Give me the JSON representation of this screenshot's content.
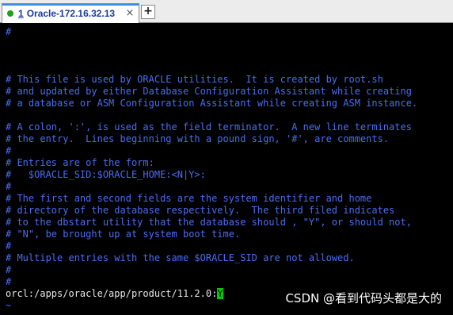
{
  "tab": {
    "number": "1",
    "title": "Oracle-172.16.32.13",
    "close_glyph": "×",
    "add_glyph": "+",
    "status_color": "#1ea21e",
    "accent_color": "#3c8de8"
  },
  "terminal": {
    "comment_color": "#4a6ef2",
    "text_color": "#e6e6e6",
    "cursor_color": "#00cc00",
    "lines": [
      "#",
      "",
      "",
      "",
      "# This file is used by ORACLE utilities.  It is created by root.sh",
      "# and updated by either Database Configuration Assistant while creating",
      "# a database or ASM Configuration Assistant while creating ASM instance.",
      "",
      "# A colon, ':', is used as the field terminator.  A new line terminates",
      "# the entry.  Lines beginning with a pound sign, '#', are comments.",
      "#",
      "# Entries are of the form:",
      "#   $ORACLE_SID:$ORACLE_HOME:<N|Y>:",
      "#",
      "# The first and second fields are the system identifier and home",
      "# directory of the database respectively.  The third filed indicates",
      "# to the dbstart utility that the database should , \"Y\", or should not,",
      "# \"N\", be brought up at system boot time.",
      "#",
      "# Multiple entries with the same $ORACLE_SID are not allowed.",
      "#",
      "#"
    ],
    "entry_prefix": "orcl:/apps/oracle/app/product/11.2.0:",
    "entry_cursor_char": "Y",
    "tilde": "~"
  },
  "watermark": "CSDN @看到代码头都是大的"
}
